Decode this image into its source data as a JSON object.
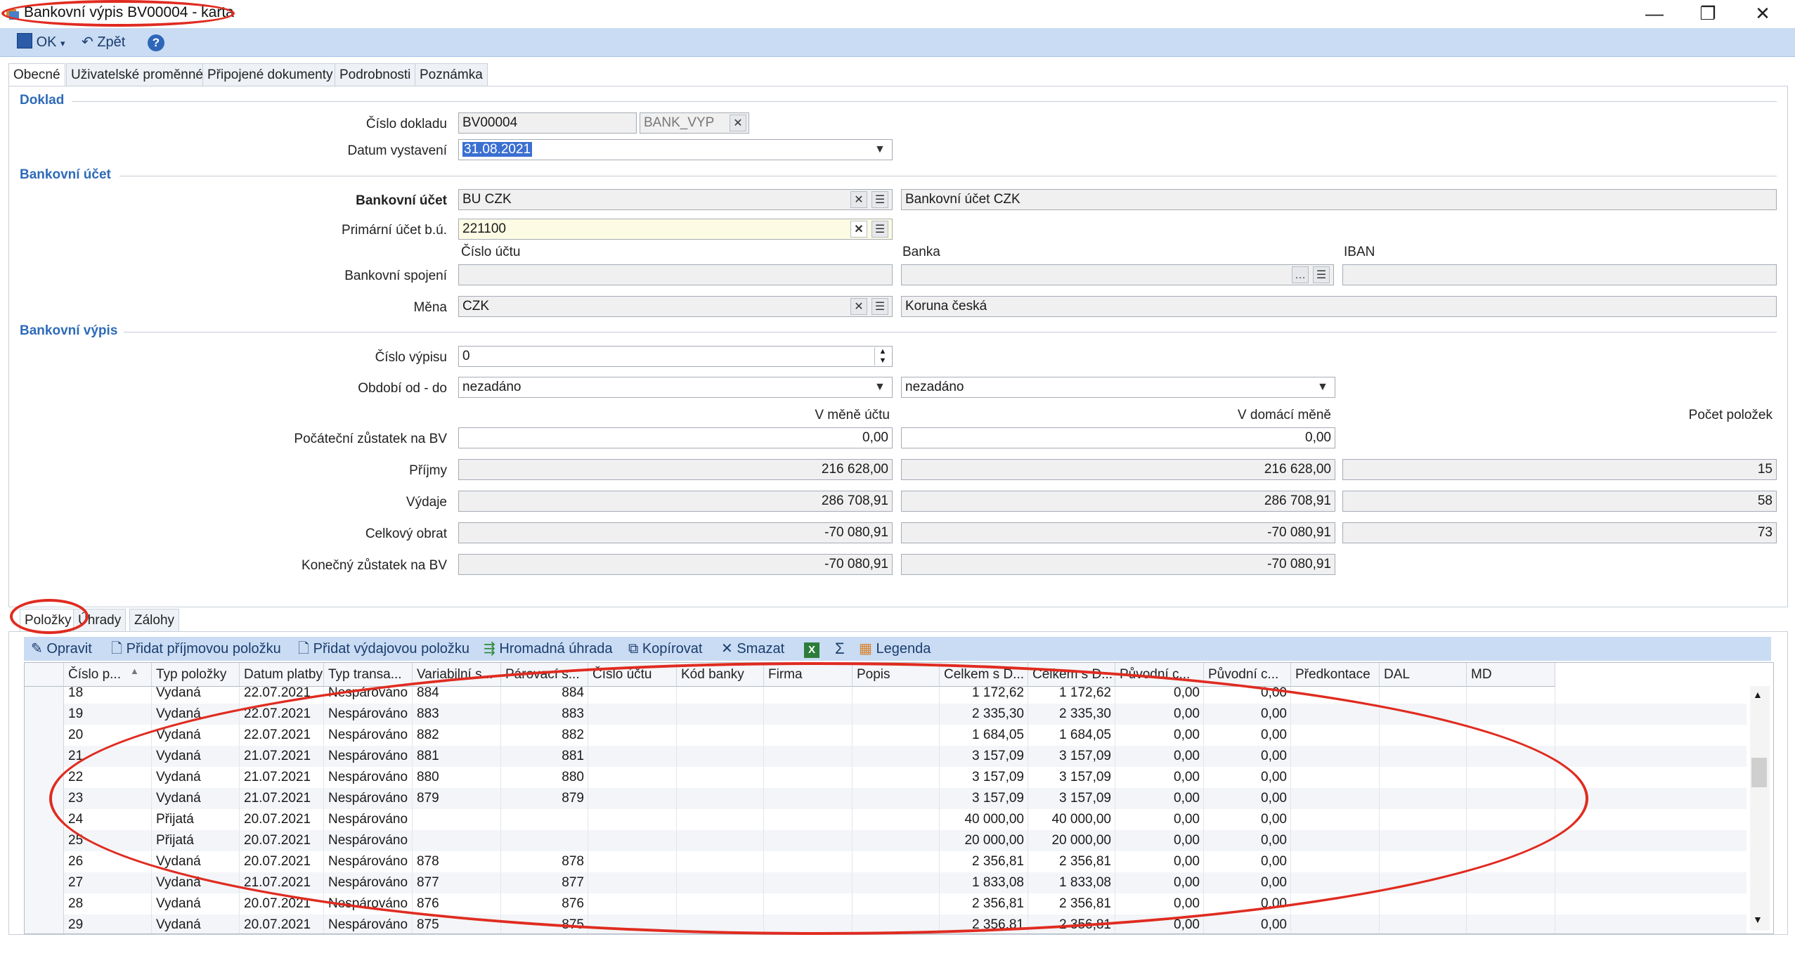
{
  "window": {
    "title": "Bankovní výpis BV00004 - karta",
    "minimize": "—",
    "restore": "❐",
    "close": "✕"
  },
  "toolbar": {
    "ok_label": "OK",
    "back_label": "Zpět",
    "help_label": "?"
  },
  "tabs": [
    "Obecné",
    "Uživatelské proměnné",
    "Připojené dokumenty",
    "Podrobnosti",
    "Poznámka"
  ],
  "doklad": {
    "section_title": "Doklad",
    "cislo_label": "Číslo dokladu",
    "cislo_value": "BV00004",
    "rada_value": "BANK_VYP",
    "datum_label": "Datum vystavení",
    "datum_value": "31.08.2021"
  },
  "bankovni_ucet": {
    "section_title": "Bankovní účet",
    "ucet_label": "Bankovní účet",
    "ucet_value": "BU CZK",
    "ucet_name": "Bankovní účet CZK",
    "primarni_label": "Primární účet b.ú.",
    "primarni_value": "221100",
    "cislo_uctu_label": "Číslo účtu",
    "banka_label": "Banka",
    "iban_label": "IBAN",
    "spojeni_label": "Bankovní spojení",
    "mena_label": "Měna",
    "mena_value": "CZK",
    "mena_name": "Koruna česká"
  },
  "bankovni_vypis": {
    "section_title": "Bankovní výpis",
    "cislo_vypisu_label": "Číslo výpisu",
    "cislo_vypisu_value": "0",
    "obdobi_label": "Období od - do",
    "obdobi_od": "nezadáno",
    "obdobi_do": "nezadáno",
    "col_mena_uctu": "V měně účtu",
    "col_domaci": "V domácí měně",
    "col_pocet": "Počet položek",
    "rows": [
      {
        "label": "Počáteční zůstatek na BV",
        "ucet": "0,00",
        "domaci": "0,00",
        "pocet": ""
      },
      {
        "label": "Příjmy",
        "ucet": "216 628,00",
        "domaci": "216 628,00",
        "pocet": "15"
      },
      {
        "label": "Výdaje",
        "ucet": "286 708,91",
        "domaci": "286 708,91",
        "pocet": "58"
      },
      {
        "label": "Celkový obrat",
        "ucet": "-70 080,91",
        "domaci": "-70 080,91",
        "pocet": "73"
      },
      {
        "label": "Konečný zůstatek na BV",
        "ucet": "-70 080,91",
        "domaci": "-70 080,91",
        "pocet": ""
      }
    ]
  },
  "bottom_tabs": [
    "Položky",
    "Úhrady",
    "Zálohy"
  ],
  "grid_toolbar": {
    "edit": "Opravit",
    "add_income": "Přidat příjmovou položku",
    "add_expense": "Přidat výdajovou položku",
    "bulk": "Hromadná úhrada",
    "copy": "Kopírovat",
    "delete": "Smazat",
    "sum": "Σ",
    "legend": "Legenda"
  },
  "grid": {
    "columns": [
      "Číslo p...",
      "Typ položky",
      "Datum platby",
      "Typ transa...",
      "Variabilní s...",
      "Párovací s...",
      "Číslo účtu",
      "Kód banky",
      "Firma",
      "Popis",
      "Celkem s D...",
      "Celkem s D...",
      "Původní c...",
      "Původní c...",
      "Předkontace",
      "DAL",
      "MD"
    ],
    "rows": [
      [
        "18",
        "Vydaná",
        "22.07.2021",
        "Nespárováno",
        "884",
        "884",
        "",
        "",
        "",
        "",
        "1 172,62",
        "1 172,62",
        "0,00",
        "0,00",
        "",
        "",
        ""
      ],
      [
        "19",
        "Vydaná",
        "22.07.2021",
        "Nespárováno",
        "883",
        "883",
        "",
        "",
        "",
        "",
        "2 335,30",
        "2 335,30",
        "0,00",
        "0,00",
        "",
        "",
        ""
      ],
      [
        "20",
        "Vydaná",
        "22.07.2021",
        "Nespárováno",
        "882",
        "882",
        "",
        "",
        "",
        "",
        "1 684,05",
        "1 684,05",
        "0,00",
        "0,00",
        "",
        "",
        ""
      ],
      [
        "21",
        "Vydaná",
        "21.07.2021",
        "Nespárováno",
        "881",
        "881",
        "",
        "",
        "",
        "",
        "3 157,09",
        "3 157,09",
        "0,00",
        "0,00",
        "",
        "",
        ""
      ],
      [
        "22",
        "Vydaná",
        "21.07.2021",
        "Nespárováno",
        "880",
        "880",
        "",
        "",
        "",
        "",
        "3 157,09",
        "3 157,09",
        "0,00",
        "0,00",
        "",
        "",
        ""
      ],
      [
        "23",
        "Vydaná",
        "21.07.2021",
        "Nespárováno",
        "879",
        "879",
        "",
        "",
        "",
        "",
        "3 157,09",
        "3 157,09",
        "0,00",
        "0,00",
        "",
        "",
        ""
      ],
      [
        "24",
        "Přijatá",
        "20.07.2021",
        "Nespárováno",
        "",
        "",
        "",
        "",
        "",
        "",
        "40 000,00",
        "40 000,00",
        "0,00",
        "0,00",
        "",
        "",
        ""
      ],
      [
        "25",
        "Přijatá",
        "20.07.2021",
        "Nespárováno",
        "",
        "",
        "",
        "",
        "",
        "",
        "20 000,00",
        "20 000,00",
        "0,00",
        "0,00",
        "",
        "",
        ""
      ],
      [
        "26",
        "Vydaná",
        "20.07.2021",
        "Nespárováno",
        "878",
        "878",
        "",
        "",
        "",
        "",
        "2 356,81",
        "2 356,81",
        "0,00",
        "0,00",
        "",
        "",
        ""
      ],
      [
        "27",
        "Vydaná",
        "21.07.2021",
        "Nespárováno",
        "877",
        "877",
        "",
        "",
        "",
        "",
        "1 833,08",
        "1 833,08",
        "0,00",
        "0,00",
        "",
        "",
        ""
      ],
      [
        "28",
        "Vydaná",
        "20.07.2021",
        "Nespárováno",
        "876",
        "876",
        "",
        "",
        "",
        "",
        "2 356,81",
        "2 356,81",
        "0,00",
        "0,00",
        "",
        "",
        ""
      ],
      [
        "29",
        "Vydaná",
        "20.07.2021",
        "Nespárováno",
        "875",
        "875",
        "",
        "",
        "",
        "",
        "2 356,81",
        "2 356,81",
        "0,00",
        "0,00",
        "",
        "",
        ""
      ]
    ]
  },
  "colors": {
    "accent": "#2e6bb8",
    "toolbar_bg": "#c9dcf3",
    "annotation": "#e02b20"
  }
}
